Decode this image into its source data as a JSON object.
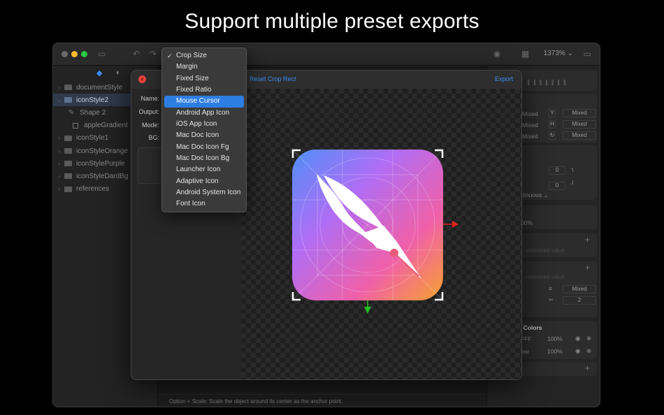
{
  "headline": "Support multiple preset exports",
  "window": {
    "zoom_label": "1373%",
    "colors": {
      "close": "#ff5f57",
      "minimize": "#febc2e",
      "zoom": "#28c840",
      "accent": "#2e7de2"
    }
  },
  "sidebar": {
    "layers": [
      {
        "label": "documentStyle",
        "type": "folder"
      },
      {
        "label": "iconStyle2",
        "type": "folder",
        "selected": true,
        "expanded": true
      },
      {
        "label": "Shape 2",
        "type": "shape"
      },
      {
        "label": "appleGradient",
        "type": "gradient"
      },
      {
        "label": "iconStyle1",
        "type": "folder"
      },
      {
        "label": "iconStyleOrange",
        "type": "folder"
      },
      {
        "label": "iconStylePurple",
        "type": "folder"
      },
      {
        "label": "iconStyleDardBg",
        "type": "folder"
      },
      {
        "label": "references",
        "type": "folder"
      }
    ]
  },
  "dialog": {
    "reset_label": "Reset Crop Rect",
    "export_label": "Export",
    "form": {
      "name_label": "Name:",
      "output_label": "Output:",
      "mode_label": "Mode:",
      "bg_label": "BG:"
    }
  },
  "dropdown": {
    "selected": "Crop Size",
    "highlighted": "Mouse Cursor",
    "options": [
      "Crop Size",
      "Margin",
      "Fixed Size",
      "Fixed Ratio",
      "Mouse Cursor",
      "Android App Icon",
      "iOS App Icon",
      "Mac Doc Icon",
      "Mac Doc Icon Fg",
      "Mac Doc Icon Bg",
      "Launcher Icon",
      "Adaptive Icon",
      "Android System Icon",
      "Font Icon"
    ]
  },
  "inspector": {
    "mixed": "Mixed",
    "zero": "0",
    "continuous_label": "ntinuous",
    "pct_100": "00%",
    "stroke_count": "2",
    "colors_title": "n Colors",
    "row1_hex": "FFF",
    "row2_hex": "ear",
    "row_pct": "100%",
    "placeholder1": "...sertmixed.value",
    "placeholder2": "...sertmixed.value"
  },
  "status": {
    "hint": "Option + Scale: Scale the object around its center as the anchor point."
  }
}
